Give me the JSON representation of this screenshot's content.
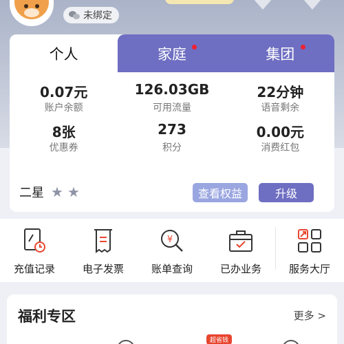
{
  "header": {
    "bind_status": "未绑定",
    "wechat_icon": "wechat-icon",
    "avatar": "bear-avatar"
  },
  "tabs": [
    {
      "label": "个人",
      "active": true,
      "dot": false
    },
    {
      "label": "家庭",
      "active": false,
      "dot": true
    },
    {
      "label": "集团",
      "active": false,
      "dot": true
    }
  ],
  "stats": [
    {
      "value": "0.07元",
      "label": "账户余额"
    },
    {
      "value": "126.03GB",
      "label": "可用流量"
    },
    {
      "value": "22分钟",
      "label": "语音剩余"
    },
    {
      "value": "8张",
      "label": "优惠券"
    },
    {
      "value": "273",
      "label": "积分"
    },
    {
      "value": "0.00元",
      "label": "消费红包"
    }
  ],
  "level": {
    "text": "二星",
    "stars": 2,
    "view_rights_label": "查看权益",
    "upgrade_label": "升级"
  },
  "services": [
    {
      "label": "充值记录",
      "icon": "recharge-record-icon"
    },
    {
      "label": "电子发票",
      "icon": "invoice-icon"
    },
    {
      "label": "账单查询",
      "icon": "bill-query-icon"
    },
    {
      "label": "已办业务",
      "icon": "handled-business-icon"
    },
    {
      "label": "服务大厅",
      "icon": "service-hall-icon"
    }
  ],
  "welfare": {
    "title": "福利专区",
    "more": "更多 >",
    "tag": "超省钱"
  },
  "colors": {
    "accent": "#6e6ec2",
    "accent_light": "#9aa6e0",
    "red_dot": "#ee2233"
  }
}
